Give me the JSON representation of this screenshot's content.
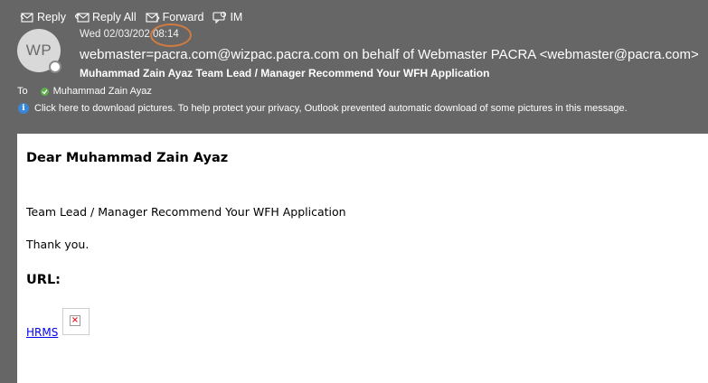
{
  "toolbar": {
    "reply": "Reply",
    "reply_all": "Reply All",
    "forward": "Forward",
    "im": "IM"
  },
  "message": {
    "avatar_initials": "WP",
    "date_prefix": "Wed 02/03/202",
    "time": "08:14",
    "from": "webmaster=pacra.com@wizpac.pacra.com on behalf of Webmaster PACRA <webmaster@pacra.com>",
    "subject": "Muhammad Zain Ayaz Team Lead / Manager Recommend Your WFH Application",
    "to_label": "To",
    "to_name": "Muhammad Zain Ayaz",
    "info_bar": "Click here to download pictures. To help protect your privacy, Outlook prevented automatic download of some pictures in this message."
  },
  "body": {
    "greeting": "Dear Muhammad Zain Ayaz",
    "line1": "Team Lead / Manager Recommend Your WFH Application",
    "line2": "Thank you.",
    "url_label": "URL:",
    "link_text": "HRMS"
  },
  "colors": {
    "header_bg": "#666666",
    "annotation_circle": "#d07b3f",
    "link": "#0000ee"
  }
}
